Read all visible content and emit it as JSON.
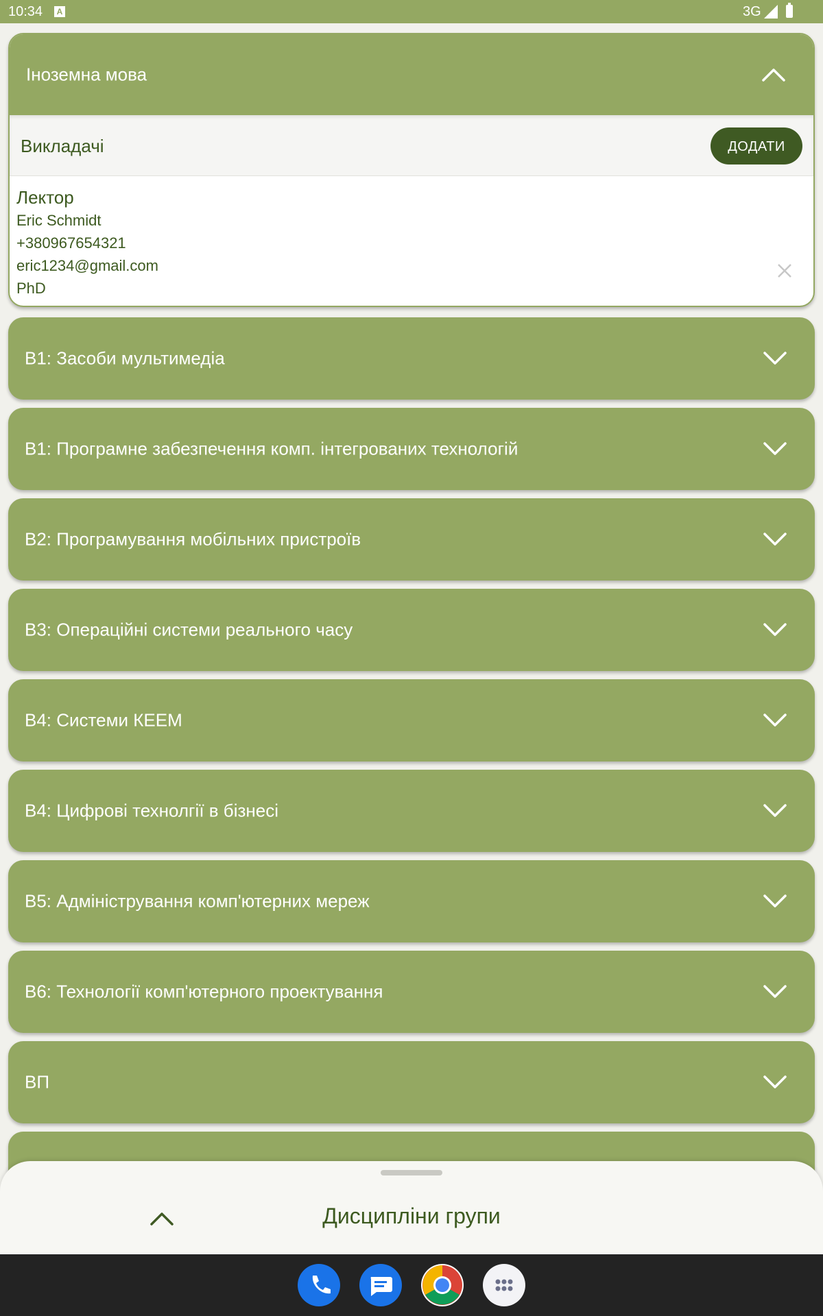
{
  "status_bar": {
    "time": "10:34",
    "a_icon": "A",
    "network": "3G"
  },
  "expanded_card": {
    "title": "Іноземна мова",
    "teachers_label": "Викладачі",
    "add_label": "ДОДАТИ",
    "teacher": {
      "role": "Лектор",
      "name": "Eric Schmidt",
      "phone": "+380967654321",
      "email": "eric1234@gmail.com",
      "degree": "PhD"
    }
  },
  "subjects": [
    {
      "title": "В1: Засоби мультимедіа"
    },
    {
      "title": "В1: Програмне забезпечення комп. інтегрованих технологій"
    },
    {
      "title": "В2: Програмування мобільних пристроїв"
    },
    {
      "title": "В3: Операційні системи реального часу"
    },
    {
      "title": "В4: Системи КЕЕМ"
    },
    {
      "title": "В4: Цифрові технолгії в бізнесі"
    },
    {
      "title": "В5: Адміністрування комп'ютерних мереж"
    },
    {
      "title": "В6: Технології комп'ютерного проектування"
    },
    {
      "title": "ВП"
    }
  ],
  "bottom_sheet": {
    "title": "Дисципліни групи"
  },
  "dock": {
    "icons": [
      "phone-icon",
      "messages-icon",
      "chrome-icon",
      "apps-icon"
    ]
  },
  "colors": {
    "card_green": "#94a862",
    "dark_green": "#3f5a23",
    "text_green": "#3d5a20"
  }
}
